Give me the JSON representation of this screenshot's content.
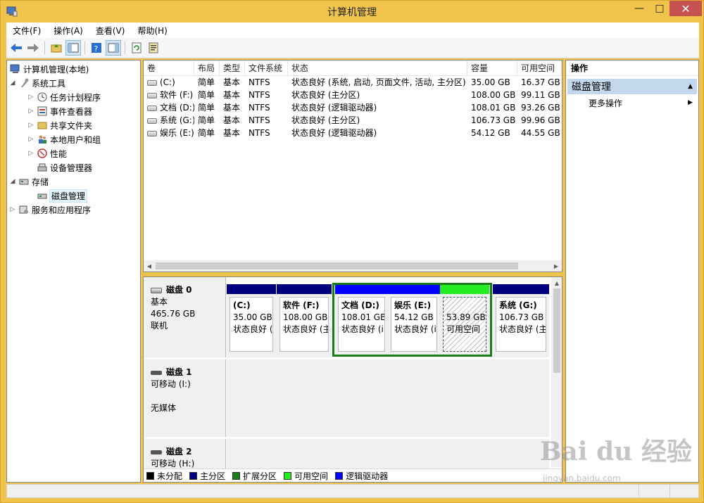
{
  "window": {
    "title": "计算机管理"
  },
  "menu": [
    "文件(F)",
    "操作(A)",
    "查看(V)",
    "帮助(H)"
  ],
  "toolbar_icons": [
    "back-arrow-icon",
    "forward-arrow-icon",
    "up-folder-icon",
    "show-hide-tree-icon",
    "help-icon",
    "show-hide-action-icon",
    "refresh-icon",
    "properties-icon"
  ],
  "tree": {
    "root": "计算机管理(本地)",
    "system_tools": "系统工具",
    "task_scheduler": "任务计划程序",
    "event_viewer": "事件查看器",
    "shared_folders": "共享文件夹",
    "local_users": "本地用户和组",
    "performance": "性能",
    "device_manager": "设备管理器",
    "storage": "存储",
    "disk_management": "磁盘管理",
    "services_apps": "服务和应用程序"
  },
  "volume_list": {
    "headers": [
      "卷",
      "布局",
      "类型",
      "文件系统",
      "状态",
      "容量",
      "可用空间"
    ],
    "rows": [
      [
        "(C:)",
        "简单",
        "基本",
        "NTFS",
        "状态良好 (系统, 启动, 页面文件, 活动, 主分区)",
        "35.00 GB",
        "16.37 GB"
      ],
      [
        "软件 (F:)",
        "简单",
        "基本",
        "NTFS",
        "状态良好 (主分区)",
        "108.00 GB",
        "99.11 GB"
      ],
      [
        "文档 (D:)",
        "简单",
        "基本",
        "NTFS",
        "状态良好 (逻辑驱动器)",
        "108.01 GB",
        "93.26 GB"
      ],
      [
        "系统 (G:)",
        "简单",
        "基本",
        "NTFS",
        "状态良好 (主分区)",
        "106.73 GB",
        "99.96 GB"
      ],
      [
        "娱乐 (E:)",
        "简单",
        "基本",
        "NTFS",
        "状态良好 (逻辑驱动器)",
        "54.12 GB",
        "44.55 GB"
      ]
    ]
  },
  "disks": {
    "disk0": {
      "name": "磁盘 0",
      "type": "基本",
      "size": "465.76 GB",
      "state": "联机",
      "partitions": {
        "c": {
          "name": "(C:)",
          "size": "35.00 GB",
          "status": "状态良好 ("
        },
        "f": {
          "name": "软件 (F:)",
          "size": "108.00 GB",
          "status": "状态良好 (主"
        },
        "d": {
          "name": "文档 (D:)",
          "size": "108.01 GB",
          "status": "状态良好 (i"
        },
        "e": {
          "name": "娱乐 (E:)",
          "size": "54.12 GB I",
          "status": "状态良好 (i"
        },
        "free": {
          "size": "53.89 GB",
          "status": "可用空间"
        },
        "g": {
          "name": "系统 (G:)",
          "size": "106.73 GB",
          "status": "状态良好 (主"
        }
      }
    },
    "disk1": {
      "name": "磁盘 1",
      "type": "可移动 (I:)",
      "media": "无媒体"
    },
    "disk2": {
      "name": "磁盘 2",
      "type": "可移动 (H:)"
    }
  },
  "legend": [
    {
      "label": "未分配",
      "color": "#000000"
    },
    {
      "label": "主分区",
      "color": "#00007f"
    },
    {
      "label": "扩展分区",
      "color": "#1a7d1a"
    },
    {
      "label": "可用空间",
      "color": "#22ee22"
    },
    {
      "label": "逻辑驱动器",
      "color": "#0000ff"
    }
  ],
  "actions": {
    "header": "操作",
    "section": "磁盘管理",
    "more": "更多操作"
  },
  "colors": {
    "primary": "#00007f",
    "logical": "#0000ff",
    "free": "#22ee22",
    "extended": "#1a7d1a",
    "section_bg": "#c3d8ec"
  },
  "watermark": {
    "main": "Bai du 经验",
    "sub": "jingyan.baidu.com"
  }
}
